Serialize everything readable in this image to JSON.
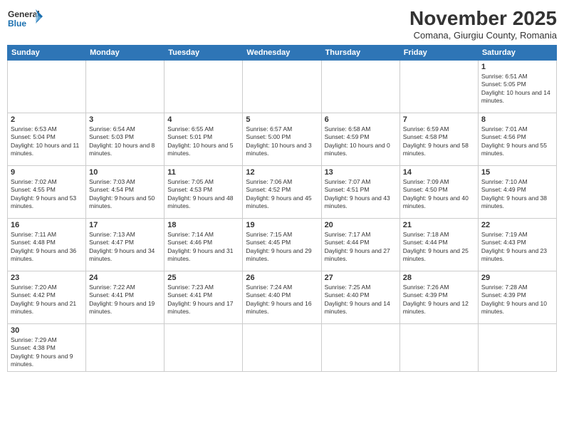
{
  "header": {
    "logo_general": "General",
    "logo_blue": "Blue",
    "month": "November 2025",
    "location": "Comana, Giurgiu County, Romania"
  },
  "weekdays": [
    "Sunday",
    "Monday",
    "Tuesday",
    "Wednesday",
    "Thursday",
    "Friday",
    "Saturday"
  ],
  "days": {
    "d1": {
      "num": "1",
      "sunrise": "6:51 AM",
      "sunset": "5:05 PM",
      "daylight": "10 hours and 14 minutes."
    },
    "d2": {
      "num": "2",
      "sunrise": "6:53 AM",
      "sunset": "5:04 PM",
      "daylight": "10 hours and 11 minutes."
    },
    "d3": {
      "num": "3",
      "sunrise": "6:54 AM",
      "sunset": "5:03 PM",
      "daylight": "10 hours and 8 minutes."
    },
    "d4": {
      "num": "4",
      "sunrise": "6:55 AM",
      "sunset": "5:01 PM",
      "daylight": "10 hours and 5 minutes."
    },
    "d5": {
      "num": "5",
      "sunrise": "6:57 AM",
      "sunset": "5:00 PM",
      "daylight": "10 hours and 3 minutes."
    },
    "d6": {
      "num": "6",
      "sunrise": "6:58 AM",
      "sunset": "4:59 PM",
      "daylight": "10 hours and 0 minutes."
    },
    "d7": {
      "num": "7",
      "sunrise": "6:59 AM",
      "sunset": "4:58 PM",
      "daylight": "9 hours and 58 minutes."
    },
    "d8": {
      "num": "8",
      "sunrise": "7:01 AM",
      "sunset": "4:56 PM",
      "daylight": "9 hours and 55 minutes."
    },
    "d9": {
      "num": "9",
      "sunrise": "7:02 AM",
      "sunset": "4:55 PM",
      "daylight": "9 hours and 53 minutes."
    },
    "d10": {
      "num": "10",
      "sunrise": "7:03 AM",
      "sunset": "4:54 PM",
      "daylight": "9 hours and 50 minutes."
    },
    "d11": {
      "num": "11",
      "sunrise": "7:05 AM",
      "sunset": "4:53 PM",
      "daylight": "9 hours and 48 minutes."
    },
    "d12": {
      "num": "12",
      "sunrise": "7:06 AM",
      "sunset": "4:52 PM",
      "daylight": "9 hours and 45 minutes."
    },
    "d13": {
      "num": "13",
      "sunrise": "7:07 AM",
      "sunset": "4:51 PM",
      "daylight": "9 hours and 43 minutes."
    },
    "d14": {
      "num": "14",
      "sunrise": "7:09 AM",
      "sunset": "4:50 PM",
      "daylight": "9 hours and 40 minutes."
    },
    "d15": {
      "num": "15",
      "sunrise": "7:10 AM",
      "sunset": "4:49 PM",
      "daylight": "9 hours and 38 minutes."
    },
    "d16": {
      "num": "16",
      "sunrise": "7:11 AM",
      "sunset": "4:48 PM",
      "daylight": "9 hours and 36 minutes."
    },
    "d17": {
      "num": "17",
      "sunrise": "7:13 AM",
      "sunset": "4:47 PM",
      "daylight": "9 hours and 34 minutes."
    },
    "d18": {
      "num": "18",
      "sunrise": "7:14 AM",
      "sunset": "4:46 PM",
      "daylight": "9 hours and 31 minutes."
    },
    "d19": {
      "num": "19",
      "sunrise": "7:15 AM",
      "sunset": "4:45 PM",
      "daylight": "9 hours and 29 minutes."
    },
    "d20": {
      "num": "20",
      "sunrise": "7:17 AM",
      "sunset": "4:44 PM",
      "daylight": "9 hours and 27 minutes."
    },
    "d21": {
      "num": "21",
      "sunrise": "7:18 AM",
      "sunset": "4:44 PM",
      "daylight": "9 hours and 25 minutes."
    },
    "d22": {
      "num": "22",
      "sunrise": "7:19 AM",
      "sunset": "4:43 PM",
      "daylight": "9 hours and 23 minutes."
    },
    "d23": {
      "num": "23",
      "sunrise": "7:20 AM",
      "sunset": "4:42 PM",
      "daylight": "9 hours and 21 minutes."
    },
    "d24": {
      "num": "24",
      "sunrise": "7:22 AM",
      "sunset": "4:41 PM",
      "daylight": "9 hours and 19 minutes."
    },
    "d25": {
      "num": "25",
      "sunrise": "7:23 AM",
      "sunset": "4:41 PM",
      "daylight": "9 hours and 17 minutes."
    },
    "d26": {
      "num": "26",
      "sunrise": "7:24 AM",
      "sunset": "4:40 PM",
      "daylight": "9 hours and 16 minutes."
    },
    "d27": {
      "num": "27",
      "sunrise": "7:25 AM",
      "sunset": "4:40 PM",
      "daylight": "9 hours and 14 minutes."
    },
    "d28": {
      "num": "28",
      "sunrise": "7:26 AM",
      "sunset": "4:39 PM",
      "daylight": "9 hours and 12 minutes."
    },
    "d29": {
      "num": "29",
      "sunrise": "7:28 AM",
      "sunset": "4:39 PM",
      "daylight": "9 hours and 10 minutes."
    },
    "d30": {
      "num": "30",
      "sunrise": "7:29 AM",
      "sunset": "4:38 PM",
      "daylight": "9 hours and 9 minutes."
    }
  }
}
